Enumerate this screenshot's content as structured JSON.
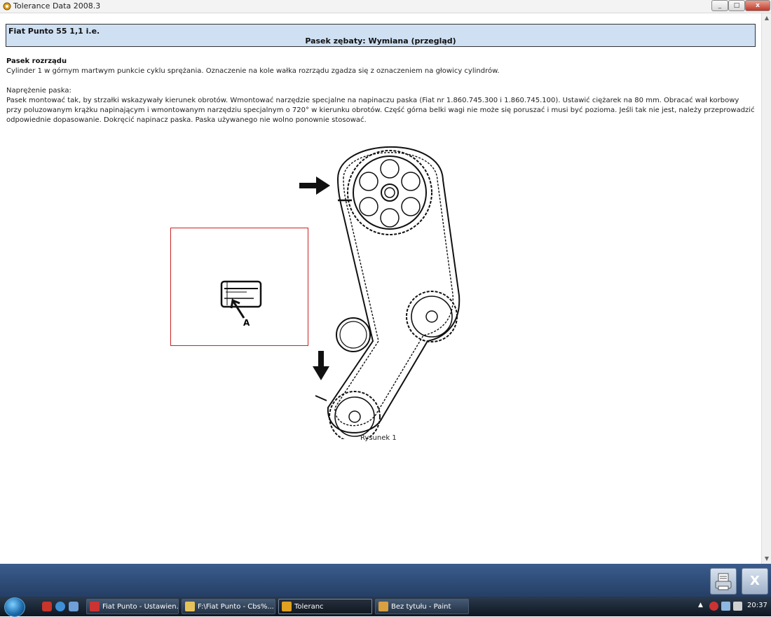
{
  "window": {
    "title": "Tolerance Data 2008.3",
    "icon": "tolerance-app-icon",
    "buttons": {
      "minimize": "_",
      "maximize": "□",
      "close": "x"
    }
  },
  "header": {
    "model": "Fiat Punto 55 1,1 i.e.",
    "procedure": "Pasek zębaty: Wymiana (przegląd)"
  },
  "body": {
    "heading": "Pasek rozrządu",
    "line1": "Cylinder 1 w górnym martwym punkcie cyklu sprężania. Oznaczenie na kole wałka rozrządu zgadza się z oznaczeniem na głowicy cylindrów.",
    "tension_label": "Naprężenie paska:",
    "tension_text": "Pasek montować tak, by strzałki wskazywały kierunek obrotów. Wmontować narzędzie specjalne na napinaczu paska (Fiat nr 1.860.745.300 i 1.860.745.100). Ustawić ciężarek na 80 mm. Obracać wał korbowy przy poluzowanym krążku napinającym i wmontowanym narzędziu specjalnym o 720° w kierunku obrotów. Część górna belki wagi nie może się poruszać i musi być pozioma. Jeśli tak nie jest, należy przeprowadzić odpowiednie dopasowanie. Dokręcić napinacz paska. Paska używanego nie wolno ponownie stosować."
  },
  "figure": {
    "inset_label": "A",
    "caption": "Rysunek 1"
  },
  "bottom_bar": {
    "print_icon": "print-icon",
    "close_label": "X"
  },
  "taskbar": {
    "items": [
      {
        "label": "Fiat Punto - Ustawien...",
        "active": false
      },
      {
        "label": "F:\\Fiat Punto - Cbs%...",
        "active": false
      },
      {
        "label": "Toleranc",
        "active": true
      },
      {
        "label": "Bez tytułu - Paint",
        "active": false
      }
    ],
    "clock": "20:37"
  },
  "colors": {
    "header_bg": "#cfe0f3",
    "inset_border": "#cc2222",
    "bottom_bar": "#2f4d78"
  }
}
